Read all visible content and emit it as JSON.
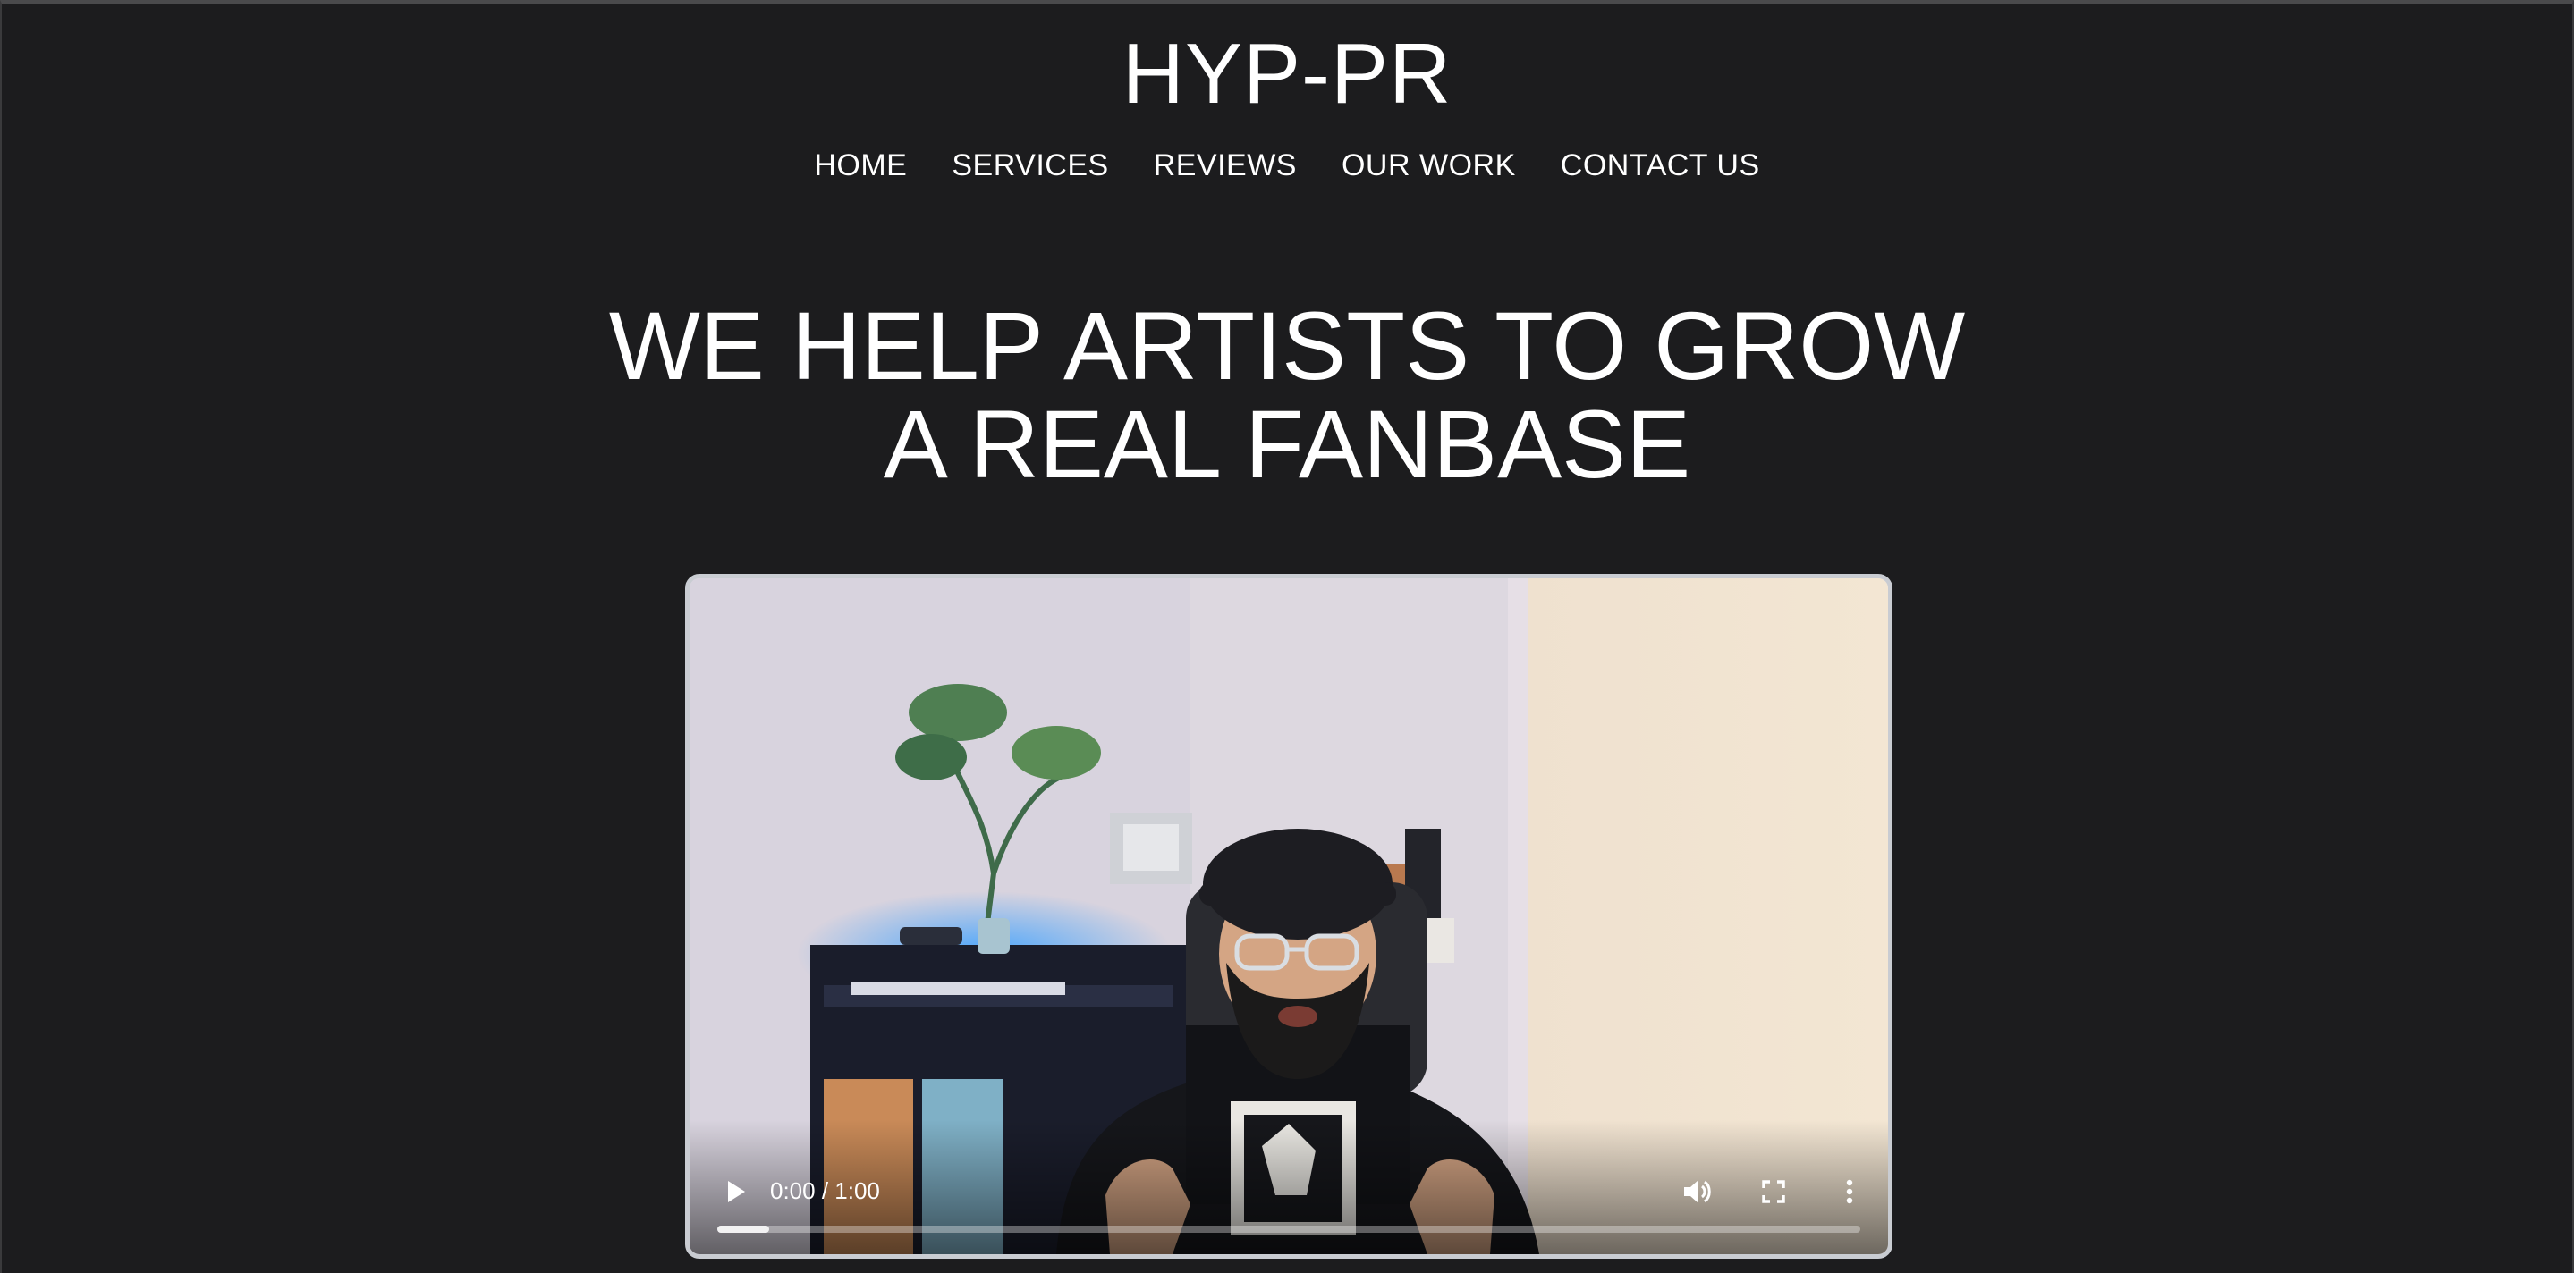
{
  "header": {
    "brand": "HYP-PR"
  },
  "nav": {
    "items": [
      {
        "label": "HOME"
      },
      {
        "label": "SERVICES"
      },
      {
        "label": "REVIEWS"
      },
      {
        "label": "OUR WORK"
      },
      {
        "label": "CONTACT US"
      }
    ]
  },
  "hero": {
    "line1": "WE HELP ARTISTS TO GROW",
    "line2": "A REAL FANBASE"
  },
  "video": {
    "time": "0:00 / 1:00",
    "buffered_fraction": 0.045,
    "icons": {
      "play": "play-icon",
      "volume": "volume-icon",
      "fullscreen": "fullscreen-icon",
      "more": "more-options-icon"
    }
  },
  "colors": {
    "background": "#1c1c1e",
    "text": "#ffffff",
    "video_border": "#c9ccd2"
  }
}
